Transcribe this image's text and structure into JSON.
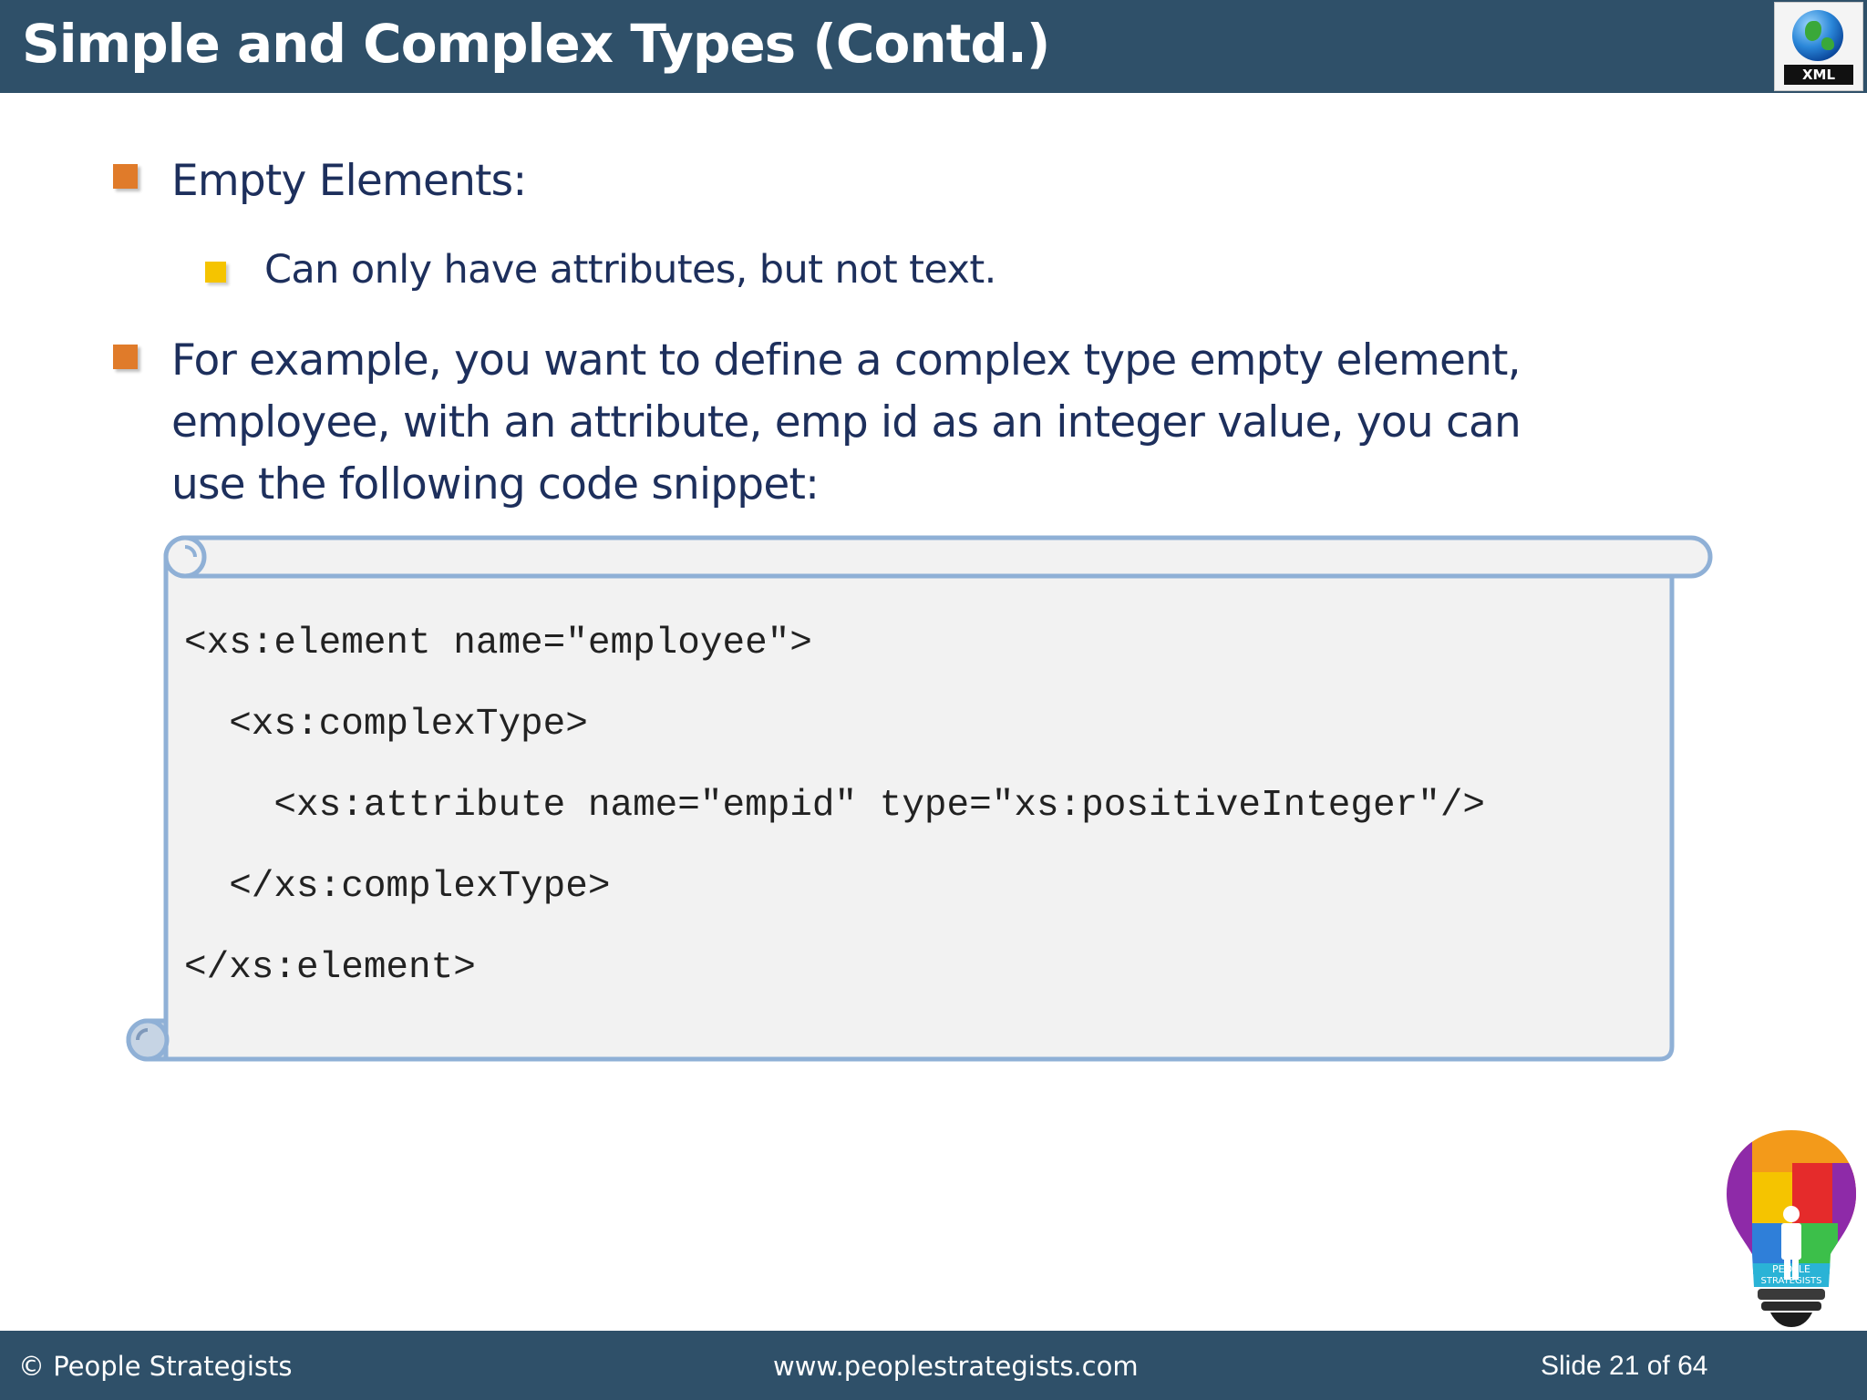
{
  "slide": {
    "title": "Simple and Complex Types (Contd.)",
    "logo_label": "XML",
    "bullets": [
      {
        "text": "Empty Elements:",
        "sub_bullets": [
          "Can only have attributes, but not text."
        ]
      },
      {
        "lines": [
          "For example, you want to define a complex type empty element,",
          "employee, with an attribute, emp id as an integer value, you can",
          "use the following code snippet:"
        ]
      }
    ],
    "code_lines": [
      "<xs:element name=\"employee\">",
      "  <xs:complexType>",
      "    <xs:attribute name=\"empid\" type=\"xs:positiveInteger\"/>",
      "  </xs:complexType>",
      "</xs:element>"
    ]
  },
  "footer": {
    "copyright": "© People Strategists",
    "website": "www.peoplestrategists.com",
    "slide_number": "Slide 21 of 64",
    "brand_logo_text": "PEOPLE STRATEGISTS"
  },
  "colors": {
    "header_bg": "#2f5069",
    "bullet_main": "#e07b2a",
    "bullet_sub": "#f5c400",
    "body_text": "#1d2f5c",
    "scroll_border": "#8fb0d6",
    "scroll_fill": "#f2f2f2"
  },
  "icons": [
    "xml-globe-icon",
    "lightbulb-puzzle-logo"
  ]
}
